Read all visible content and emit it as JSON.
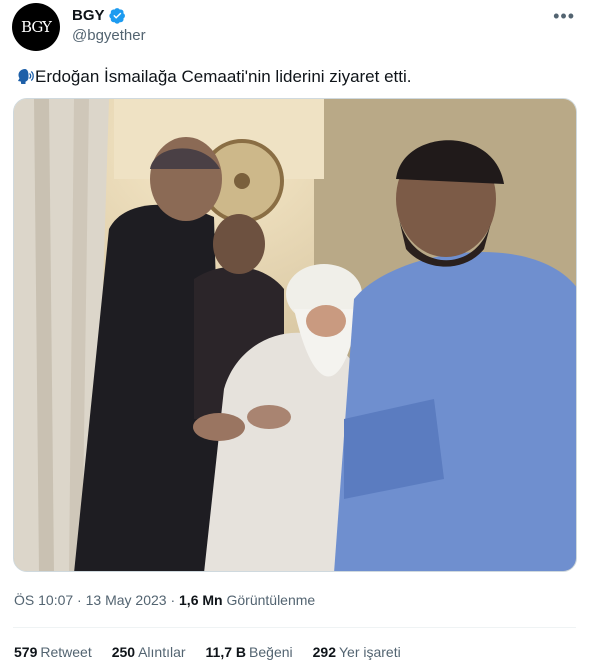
{
  "author": {
    "avatar_text": "BGY",
    "name": "BGY",
    "handle": "@bgyether",
    "verified_color": "#1d9bf0"
  },
  "tweet": {
    "text": "Erdoğan İsmailağa Cemaati'nin liderini ziyaret etti.",
    "leading_emoji": "speaking-head-icon"
  },
  "meta": {
    "time": "ÖS 10:07",
    "date": "13 May 2023",
    "views_count": "1,6 Mn",
    "views_label": "Görüntülenme"
  },
  "stats": {
    "retweets_count": "579",
    "retweets_label": "Retweet",
    "quotes_count": "250",
    "quotes_label": "Alıntılar",
    "likes_count": "11,7 B",
    "likes_label": "Beğeni",
    "bookmarks_count": "292",
    "bookmarks_label": "Yer işareti"
  }
}
